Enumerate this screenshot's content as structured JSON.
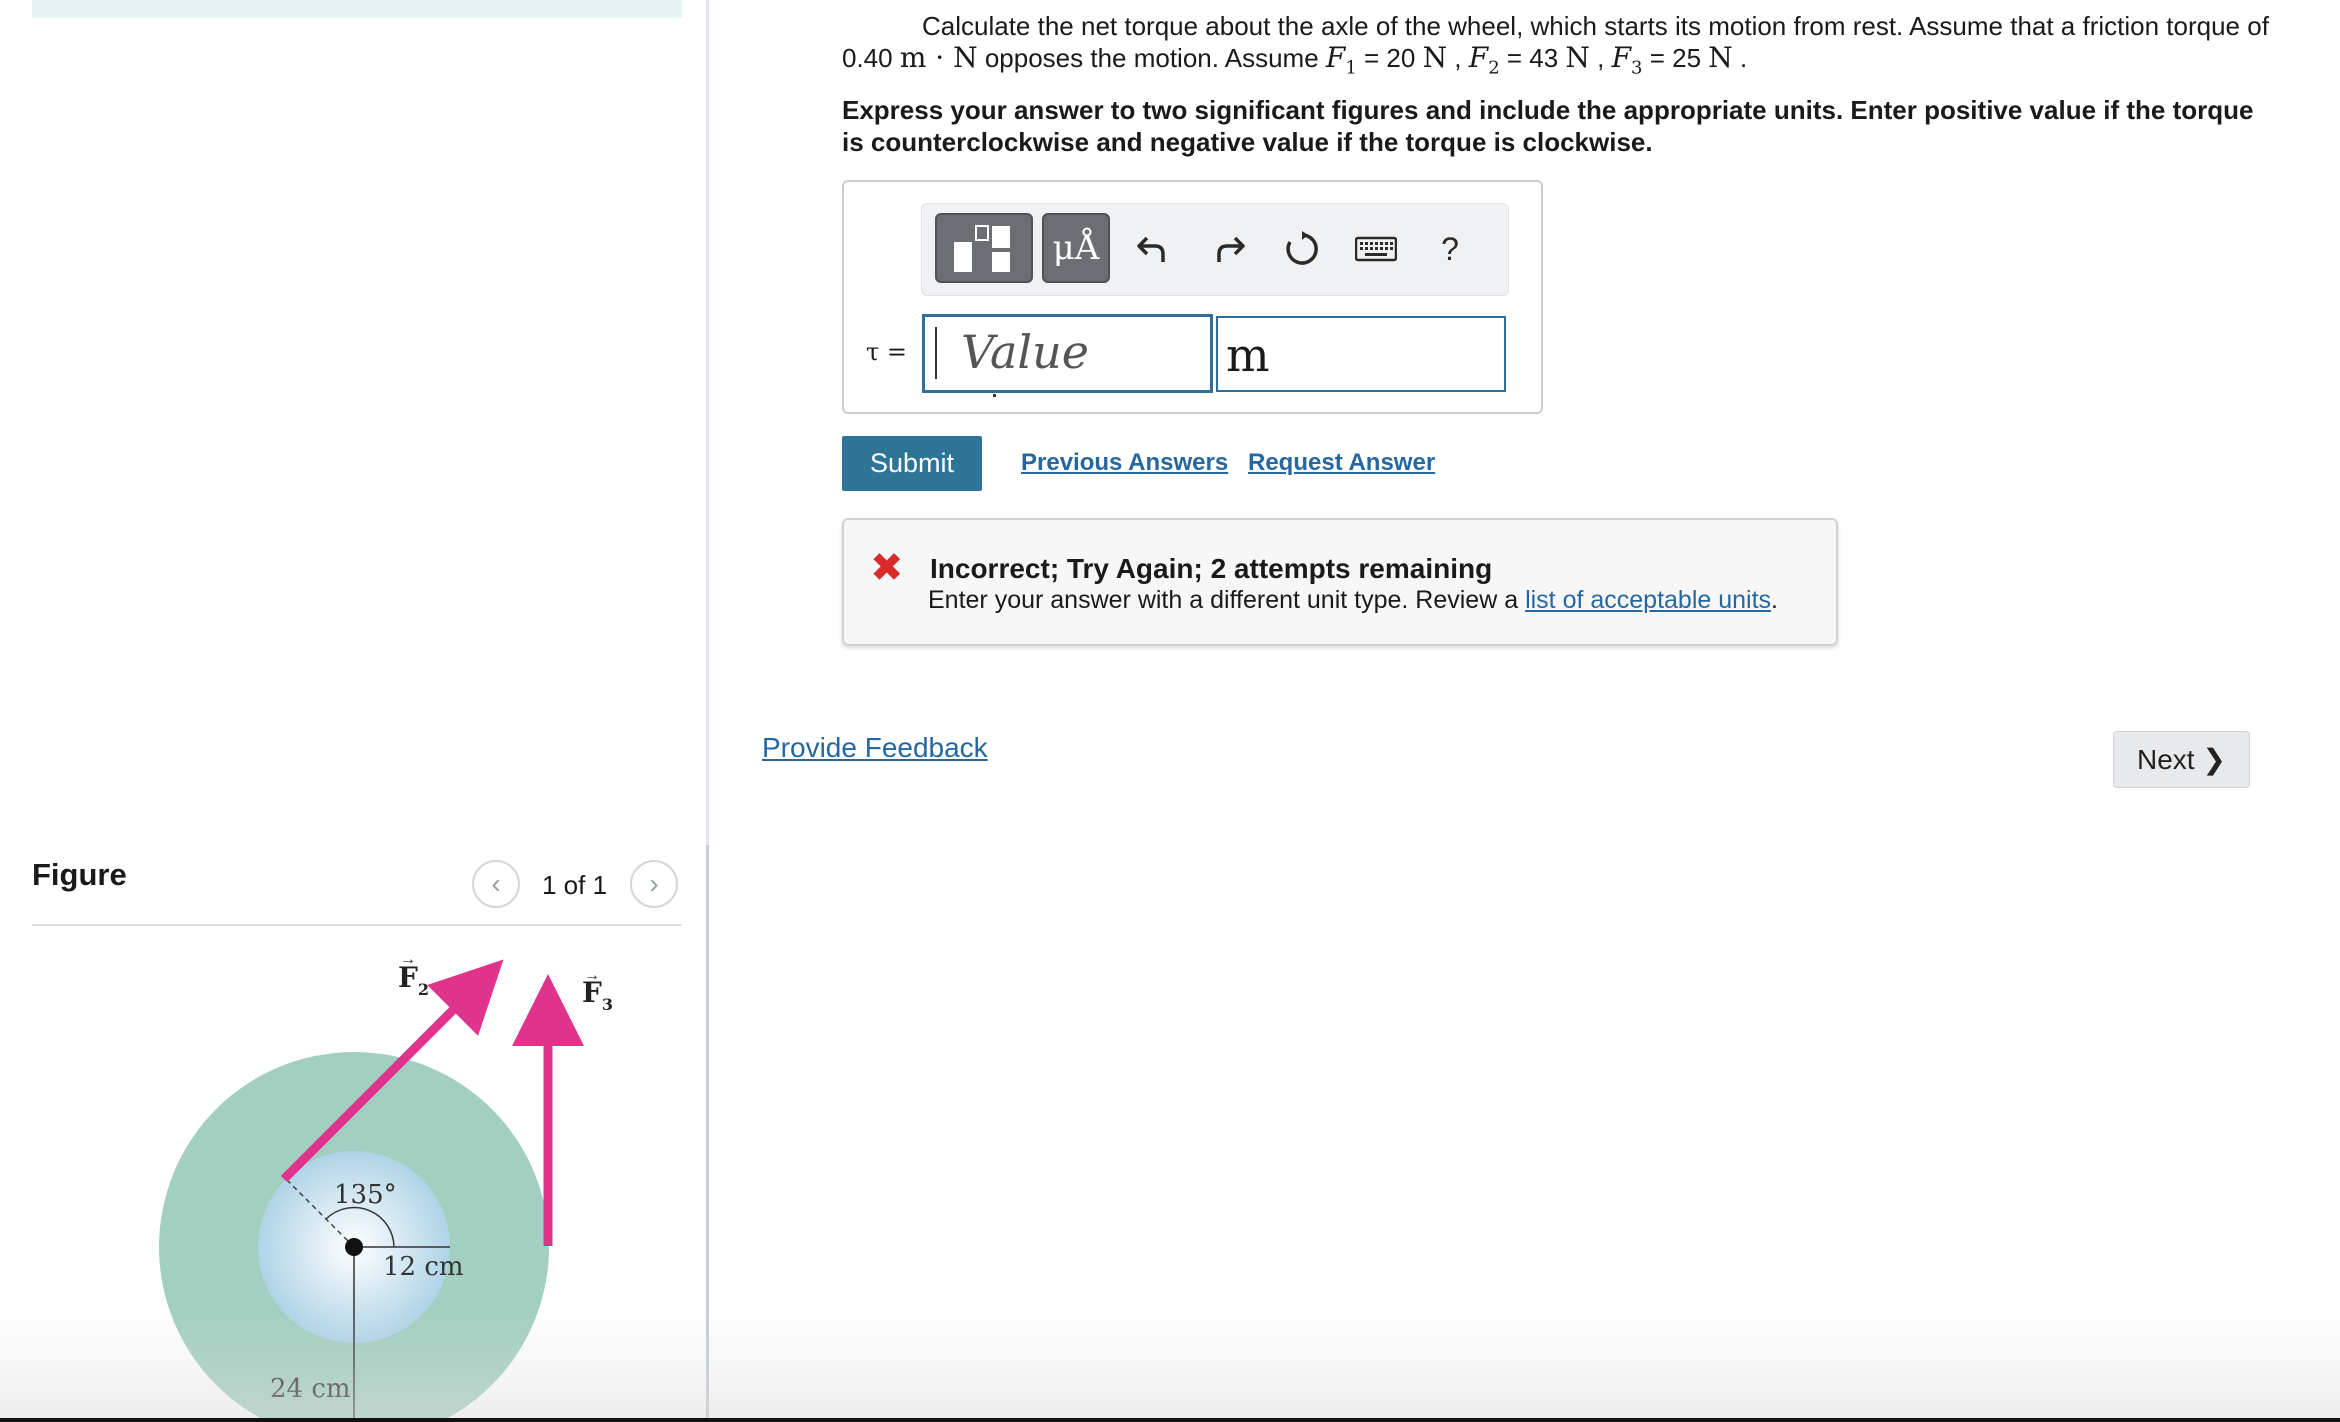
{
  "question": {
    "text_part1": "Calculate the net torque about the axle of the wheel, which starts its motion from rest. Assume that a friction torque of 0.40 ",
    "friction_unit": "m · N",
    "text_part2": " opposes the motion. Assume ",
    "f1_label": "F",
    "f1_sub": "1",
    "f1_value": " = 20 ",
    "f2_label": "F",
    "f2_sub": "2",
    "f2_value": " = 43 ",
    "f3_label": "F",
    "f3_sub": "3",
    "f3_value": " = 25 ",
    "unit_N": "N",
    "sep": " , ",
    "end": " .",
    "instructions": "Express your answer to two significant figures and include the appropriate units. Enter positive value if the torque is counterclockwise and negative value if the torque is clockwise."
  },
  "toolbar": {
    "templates_icon": "templates-icon",
    "units_label": "μÅ",
    "undo_icon": "undo-icon",
    "redo_icon": "redo-icon",
    "reset_icon": "reset-icon",
    "keyboard_icon": "keyboard-icon",
    "help_label": "?"
  },
  "answer": {
    "label": "τ =",
    "value_placeholder": "Value",
    "unit_value": "m"
  },
  "actions": {
    "submit": "Submit",
    "previous_answers": "Previous Answers",
    "request_answer": "Request Answer"
  },
  "feedback": {
    "title": "Incorrect; Try Again; 2 attempts remaining",
    "message_prefix": "Enter your answer with a different unit type. Review a ",
    "link": "list of acceptable units",
    "message_suffix": "."
  },
  "footer": {
    "provide_feedback": "Provide Feedback",
    "next": "Next"
  },
  "figure": {
    "title": "Figure",
    "counter": "1 of 1",
    "prev_glyph": "‹",
    "next_glyph": "›",
    "labels": {
      "f2": "F",
      "f2_sub": "2",
      "f3": "F",
      "f3_sub": "3",
      "angle": "135°",
      "inner_radius": "12 cm",
      "outer_radius": "24 cm"
    },
    "colors": {
      "outer_wheel": "#a3cfc0",
      "inner_hub": "#b9dbea",
      "force_arrow": "#e0338c"
    }
  }
}
